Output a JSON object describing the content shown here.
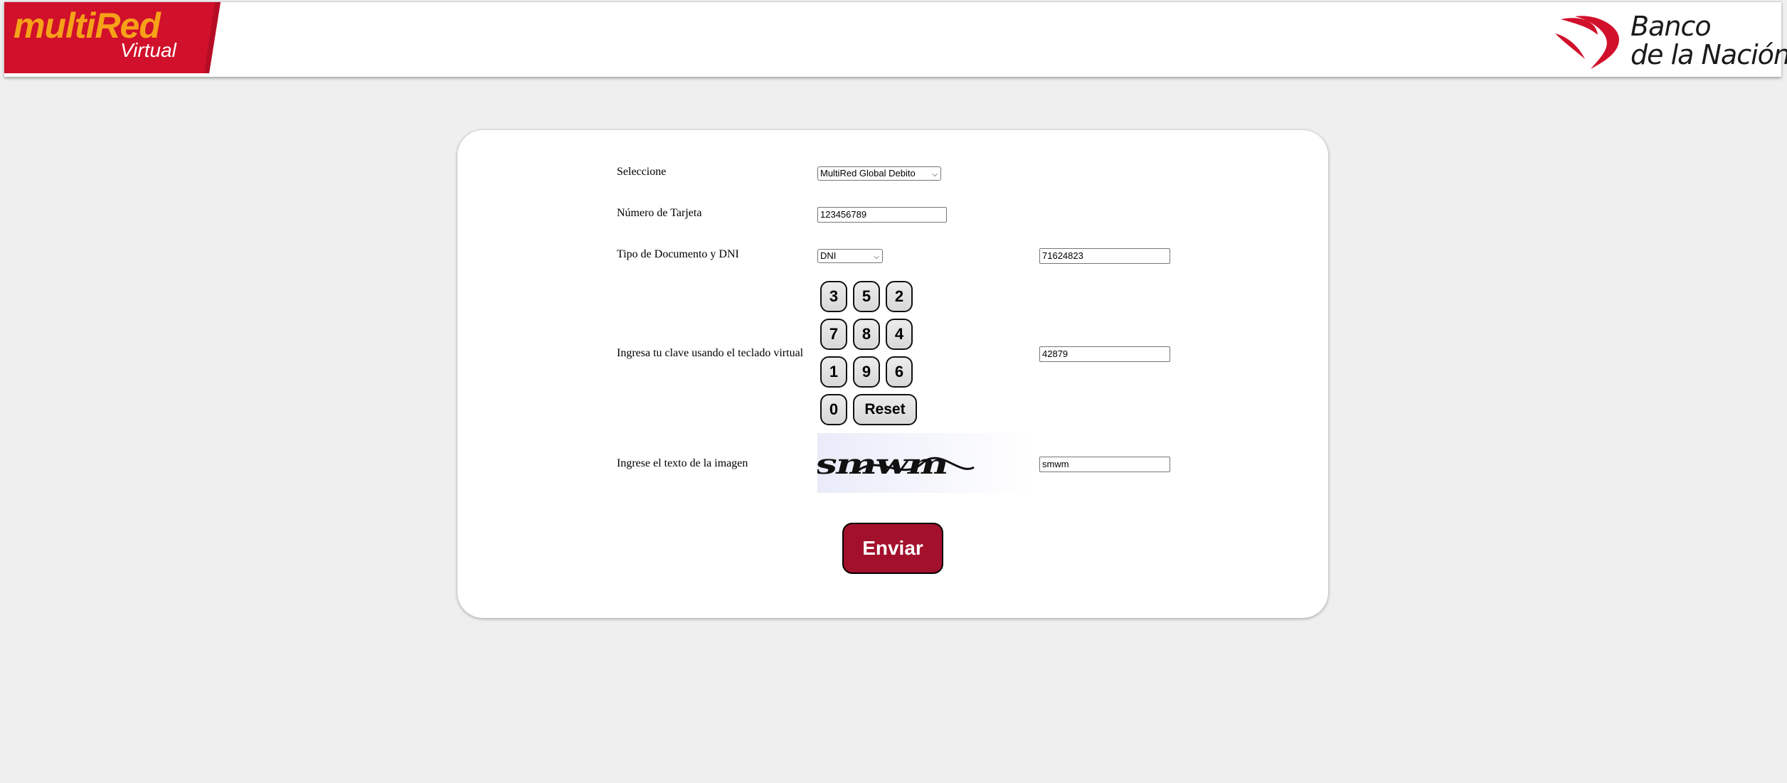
{
  "header": {
    "brand_left_main": "multiRed",
    "brand_left_sub": "Virtual",
    "brand_right_line1": "Banco",
    "brand_right_line2": "de la Nación"
  },
  "colors": {
    "brand_red": "#d1102b",
    "accent_orange": "#f6a219",
    "button_red": "#a3102c",
    "page_bg": "#efefef"
  },
  "form": {
    "seleccione": {
      "label": "Seleccione",
      "value": "MultiRed Global Debito"
    },
    "tarjeta": {
      "label": "Número de Tarjeta",
      "value": "123456789"
    },
    "documento": {
      "label": "Tipo de Documento y DNI",
      "type_value": "DNI",
      "dni_value": "71624823"
    },
    "clave": {
      "label": "Ingresa tu clave usando el teclado virtual",
      "keys": [
        "3",
        "5",
        "2",
        "7",
        "8",
        "4",
        "1",
        "9",
        "6",
        "0"
      ],
      "reset_label": "Reset",
      "value": "42879"
    },
    "captcha": {
      "label": "Ingrese el texto de la imagen",
      "image_text": "smwm",
      "value": "smwm"
    },
    "submit_label": "Enviar"
  }
}
